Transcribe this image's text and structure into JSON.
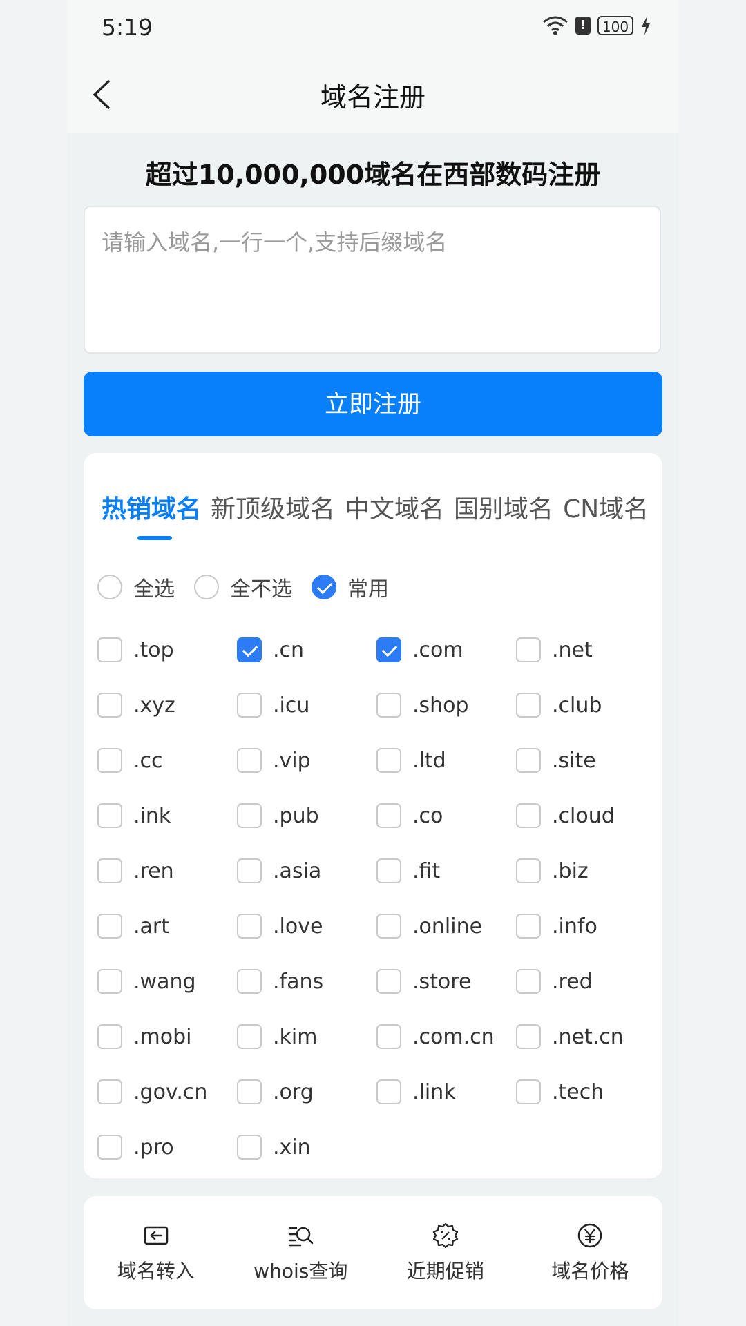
{
  "status_bar": {
    "time": "5:19",
    "battery": "100"
  },
  "header": {
    "title": "域名注册"
  },
  "subtitle": "超过10,000,000域名在西部数码注册",
  "input": {
    "placeholder": "请输入域名,一行一个,支持后缀域名",
    "value": ""
  },
  "register_button": "立即注册",
  "tabs": [
    {
      "label": "热销域名",
      "active": true
    },
    {
      "label": "新顶级域名",
      "active": false
    },
    {
      "label": "中文域名",
      "active": false
    },
    {
      "label": "国别域名",
      "active": false
    },
    {
      "label": "CN域名",
      "active": false
    }
  ],
  "select_options": [
    {
      "label": "全选",
      "checked": false
    },
    {
      "label": "全不选",
      "checked": false
    },
    {
      "label": "常用",
      "checked": true
    }
  ],
  "domains": [
    [
      {
        "label": ".top",
        "checked": false
      },
      {
        "label": ".cn",
        "checked": true
      },
      {
        "label": ".com",
        "checked": true
      },
      {
        "label": ".net",
        "checked": false
      }
    ],
    [
      {
        "label": ".xyz",
        "checked": false
      },
      {
        "label": ".icu",
        "checked": false
      },
      {
        "label": ".shop",
        "checked": false
      },
      {
        "label": ".club",
        "checked": false
      }
    ],
    [
      {
        "label": ".cc",
        "checked": false
      },
      {
        "label": ".vip",
        "checked": false
      },
      {
        "label": ".ltd",
        "checked": false
      },
      {
        "label": ".site",
        "checked": false
      }
    ],
    [
      {
        "label": ".ink",
        "checked": false
      },
      {
        "label": ".pub",
        "checked": false
      },
      {
        "label": ".co",
        "checked": false
      },
      {
        "label": ".cloud",
        "checked": false
      }
    ],
    [
      {
        "label": ".ren",
        "checked": false
      },
      {
        "label": ".asia",
        "checked": false
      },
      {
        "label": ".fit",
        "checked": false
      },
      {
        "label": ".biz",
        "checked": false
      }
    ],
    [
      {
        "label": ".art",
        "checked": false
      },
      {
        "label": ".love",
        "checked": false
      },
      {
        "label": ".online",
        "checked": false
      },
      {
        "label": ".info",
        "checked": false
      }
    ],
    [
      {
        "label": ".wang",
        "checked": false
      },
      {
        "label": ".fans",
        "checked": false
      },
      {
        "label": ".store",
        "checked": false
      },
      {
        "label": ".red",
        "checked": false
      }
    ],
    [
      {
        "label": ".mobi",
        "checked": false
      },
      {
        "label": ".kim",
        "checked": false
      },
      {
        "label": ".com.cn",
        "checked": false
      },
      {
        "label": ".net.cn",
        "checked": false
      }
    ],
    [
      {
        "label": ".gov.cn",
        "checked": false
      },
      {
        "label": ".org",
        "checked": false
      },
      {
        "label": ".link",
        "checked": false
      },
      {
        "label": ".tech",
        "checked": false
      }
    ],
    [
      {
        "label": ".pro",
        "checked": false
      },
      {
        "label": ".xin",
        "checked": false
      }
    ]
  ],
  "bottom_nav": [
    {
      "label": "域名转入",
      "icon": "transfer-icon"
    },
    {
      "label": "whois查询",
      "icon": "search-list-icon"
    },
    {
      "label": "近期促销",
      "icon": "discount-badge-icon"
    },
    {
      "label": "域名价格",
      "icon": "yuan-icon"
    }
  ],
  "colors": {
    "accent": "#087ffb",
    "tab_active": "#0a7ef5",
    "check_on": "#2c7cf6"
  }
}
